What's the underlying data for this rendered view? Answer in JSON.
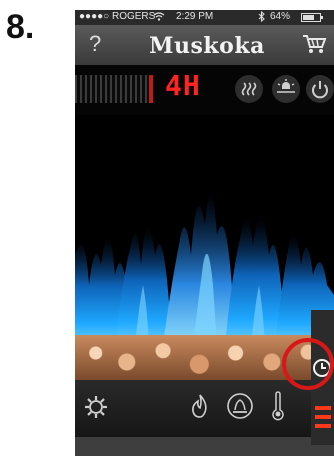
{
  "step_label": "8.",
  "status_bar": {
    "carrier": "●●●●○ ROGERS",
    "wifi_icon": "wifi-icon",
    "time": "2:29 PM",
    "bluetooth_icon": "bluetooth-icon",
    "battery": "64%"
  },
  "header": {
    "help_label": "?",
    "brand": "Muskoka",
    "cart_icon": "cart-icon"
  },
  "controls": {
    "timer_display": "4H",
    "heat_icon": "heat-icon",
    "light_icon": "light-icon",
    "power_icon": "power-icon"
  },
  "bottom_bar": {
    "settings_icon": "gear-icon",
    "flame_icon": "flame-icon",
    "ember_icon": "ember-bed-icon",
    "thermometer_icon": "thermometer-icon",
    "timer_icon": "timer-icon"
  },
  "colors": {
    "accent_red": "#ff2424",
    "flame_blue": "#1ea8ff",
    "highlight_red": "#d81818"
  }
}
